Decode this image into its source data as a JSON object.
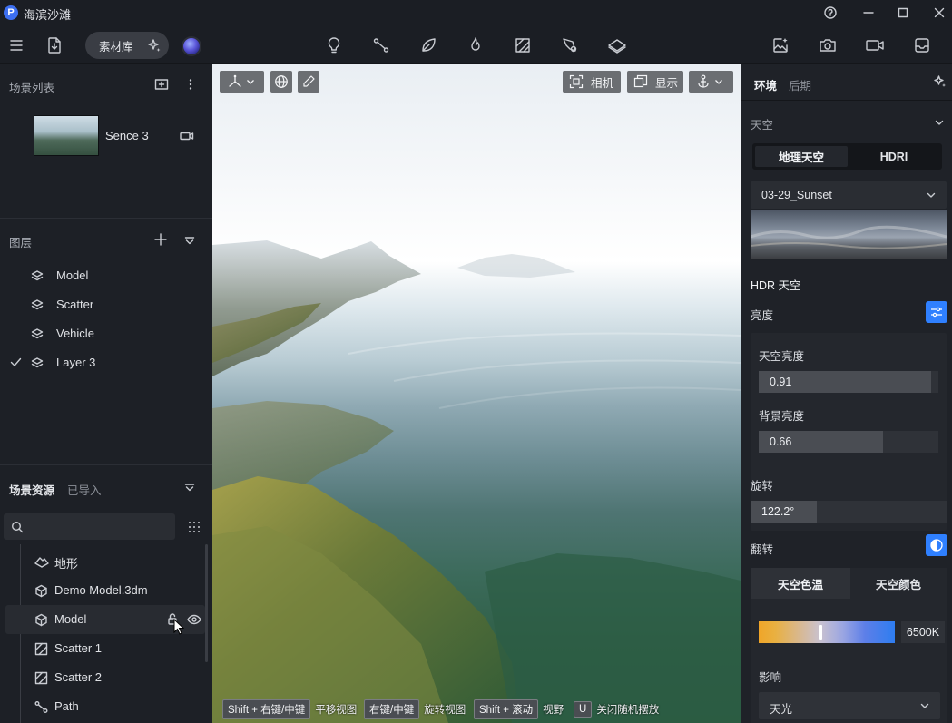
{
  "app": {
    "title": "海滨沙滩",
    "logo_letter": "P"
  },
  "toolbar": {
    "asset_library_label": "素材库"
  },
  "scene_panel": {
    "title": "场景列表",
    "scene_name": "Sence 3"
  },
  "layers_panel": {
    "title": "图层",
    "items": [
      {
        "label": "Model",
        "checked": false
      },
      {
        "label": "Scatter",
        "checked": false
      },
      {
        "label": "Vehicle",
        "checked": false
      },
      {
        "label": "Layer 3",
        "checked": true
      }
    ]
  },
  "assets_panel": {
    "tab_scene_assets": "场景资源",
    "tab_imported": "已导入",
    "search_placeholder": "",
    "items": [
      {
        "label": "地形",
        "icon": "terrain-icon"
      },
      {
        "label": "Demo Model.3dm",
        "icon": "cube-icon"
      },
      {
        "label": "Model",
        "icon": "cube-icon",
        "hovered": true
      },
      {
        "label": "Scatter 1",
        "icon": "scatter-icon"
      },
      {
        "label": "Scatter 2",
        "icon": "scatter-icon"
      },
      {
        "label": "Path",
        "icon": "path-icon"
      }
    ]
  },
  "viewport": {
    "camera_label": "相机",
    "display_label": "显示",
    "hints": [
      {
        "key": "Shift + 右键/中键",
        "desc": "平移视图"
      },
      {
        "key": "右键/中键",
        "desc": "旋转视图"
      },
      {
        "key": "Shift + 滚动",
        "desc": "视野"
      },
      {
        "key": "U",
        "desc": "关闭随机摆放"
      }
    ]
  },
  "right_panel": {
    "tab_environment": "环境",
    "tab_post": "后期",
    "sky_section": "天空",
    "sky_tab_geo": "地理天空",
    "sky_tab_hdri": "HDRI",
    "hdri_selected": "03-29_Sunset",
    "hdr_sky_label": "HDR 天空",
    "brightness_label": "亮度",
    "sky_brightness_label": "天空亮度",
    "sky_brightness_value": "0.91",
    "sky_brightness_fraction": 0.96,
    "bg_brightness_label": "背景亮度",
    "bg_brightness_value": "0.66",
    "bg_brightness_fraction": 0.69,
    "rotation_label": "旋转",
    "rotation_value": "122.2°",
    "flip_label": "翻转",
    "tab_color_temp": "天空色温",
    "tab_sky_color": "天空颜色",
    "color_temp_value": "6500K",
    "color_temp_fraction": 0.45,
    "influence_label": "影响",
    "influence_selected": "天光"
  },
  "colors": {
    "accent": "#2f80ff",
    "panel": "#1f2228",
    "background": "#1b1e24"
  }
}
